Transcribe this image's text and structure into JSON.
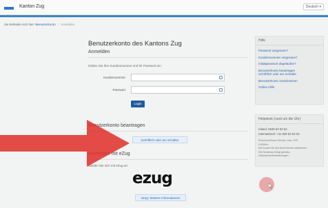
{
  "header": {
    "brand": "Kanton Zug",
    "language": "Deutsch ▾"
  },
  "breadcrumb": {
    "prefix": "Sie befinden sich hier:",
    "link": "Benutzerkonto",
    "separator": "/",
    "current": "Anmelden"
  },
  "main": {
    "title": "Benutzerkonto des Kantons Zug",
    "login": {
      "heading": "Anmelden",
      "instruction": "Geben Sie Ihre Kundennummer und Ihr Passwort ein",
      "customer_label": "Kundennummer",
      "password_label": "Passwort",
      "login_button": "Login"
    },
    "apply": {
      "heading": "Benutzerkonto beantragen",
      "button": "Schriftlich oder am Schalter"
    },
    "ezug": {
      "heading": "Anmelden mit eZug",
      "instruction": "Melden Sie sich mit eZug an:",
      "logo_text": "ezug",
      "button": "eZug: Weitere Informationen"
    }
  },
  "sidebar": {
    "help": {
      "heading": "Hilfe",
      "links": [
        "Passwort vergessen?",
        "Kundennummer vergessen?",
        "Initialpasswort abgelaufen?",
        "Benutzerkonto beantragen",
        "Schriftlich oder am Schalter",
        "Benutzerkonto zurücksetzen",
        "Online Hilfe"
      ]
    },
    "helpdesk": {
      "heading": "Helpdesk (rund um die Uhr)",
      "lines": [
        "Inland: 0848 63 63 63",
        "International: +41 848 63 63 63"
      ],
      "fine_print": [
        "Einwohnerfinanz Service, max. CHF",
        "0.08/Min.",
        "Die Kosten für den Anruf können abweichen.",
        "Die Beratung erfolgt gemäss",
        "Datenschutzbestimmungen."
      ]
    }
  },
  "colors": {
    "accent": "#1f6fb8",
    "link": "#2a6ab0",
    "arrow": "#e0332f",
    "login_button": "#1f5b9e"
  },
  "icons": {
    "arrow": "red-arrow-annotation",
    "cursor": "mouse-cursor-icon"
  }
}
